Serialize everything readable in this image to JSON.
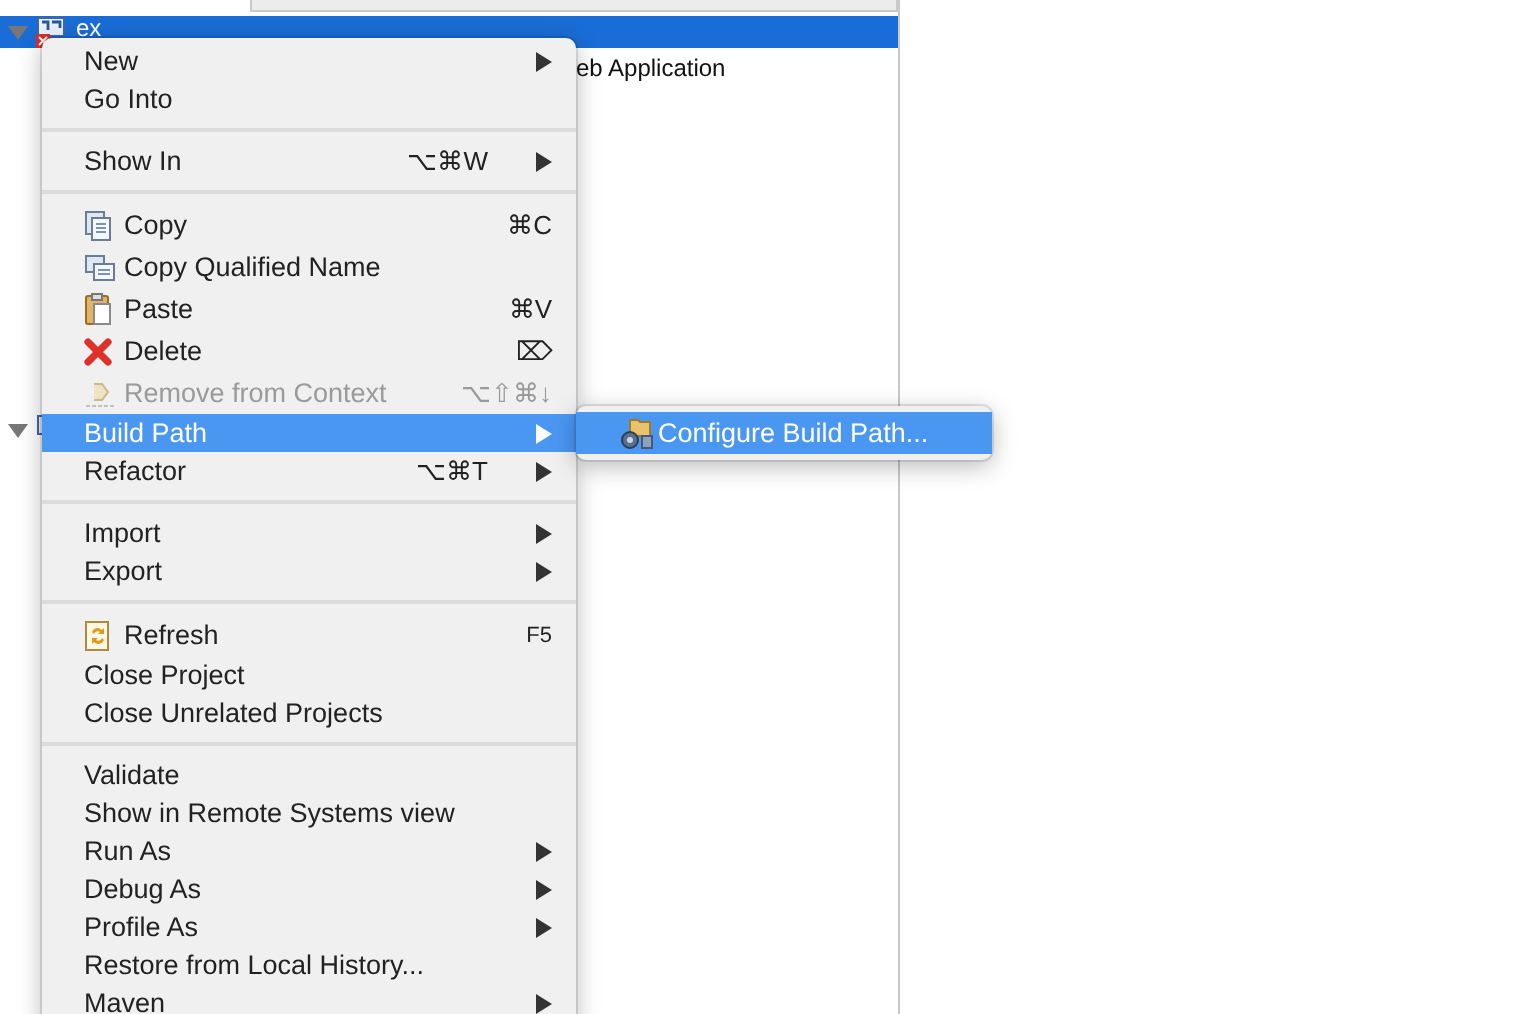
{
  "tree": [
    {
      "label": "ex",
      "selected": true,
      "expanded": true,
      "error": true,
      "children": [
        {
          "label": "eb Application"
        }
      ]
    },
    {
      "expanded": true,
      "error": false
    }
  ],
  "context_menu": [
    {
      "kind": "item",
      "label": "New",
      "submenu": true
    },
    {
      "kind": "item",
      "label": "Go Into"
    },
    {
      "kind": "separator"
    },
    {
      "kind": "item",
      "label": "Show In",
      "shortcut": "⌥⌘W",
      "submenu": true
    },
    {
      "kind": "separator"
    },
    {
      "kind": "icon_item",
      "label": "Copy",
      "shortcut": "⌘C"
    },
    {
      "kind": "icon_item",
      "label": "Copy Qualified Name"
    },
    {
      "kind": "icon_item",
      "label": "Paste",
      "shortcut": "⌘V"
    },
    {
      "kind": "icon_item",
      "label": "Delete",
      "shortcut": "⌦"
    },
    {
      "kind": "icon_item",
      "label": "Remove from Context",
      "shortcut": "⌥⇧⌘↓",
      "disabled": true
    },
    {
      "kind": "item",
      "label": "Build Path",
      "submenu": true,
      "selected": true
    },
    {
      "kind": "item",
      "label": "Refactor",
      "shortcut": "⌥⌘T",
      "submenu": true
    },
    {
      "kind": "separator"
    },
    {
      "kind": "item",
      "label": "Import",
      "submenu": true
    },
    {
      "kind": "item",
      "label": "Export",
      "submenu": true
    },
    {
      "kind": "separator"
    },
    {
      "kind": "icon_item",
      "label": "Refresh",
      "shortcut": "F5"
    },
    {
      "kind": "item",
      "label": "Close Project"
    },
    {
      "kind": "item",
      "label": "Close Unrelated Projects"
    },
    {
      "kind": "separator"
    },
    {
      "kind": "item",
      "label": "Validate"
    },
    {
      "kind": "item",
      "label": "Show in Remote Systems view"
    },
    {
      "kind": "item",
      "label": "Run As",
      "submenu": true
    },
    {
      "kind": "item",
      "label": "Debug As",
      "submenu": true
    },
    {
      "kind": "item",
      "label": "Profile As",
      "submenu": true
    },
    {
      "kind": "item",
      "label": "Restore from Local History..."
    },
    {
      "kind": "item",
      "label": "Maven",
      "submenu": true
    }
  ],
  "submenu": [
    {
      "kind": "icon_item",
      "label": "Configure Build Path...",
      "selected": true
    }
  ]
}
